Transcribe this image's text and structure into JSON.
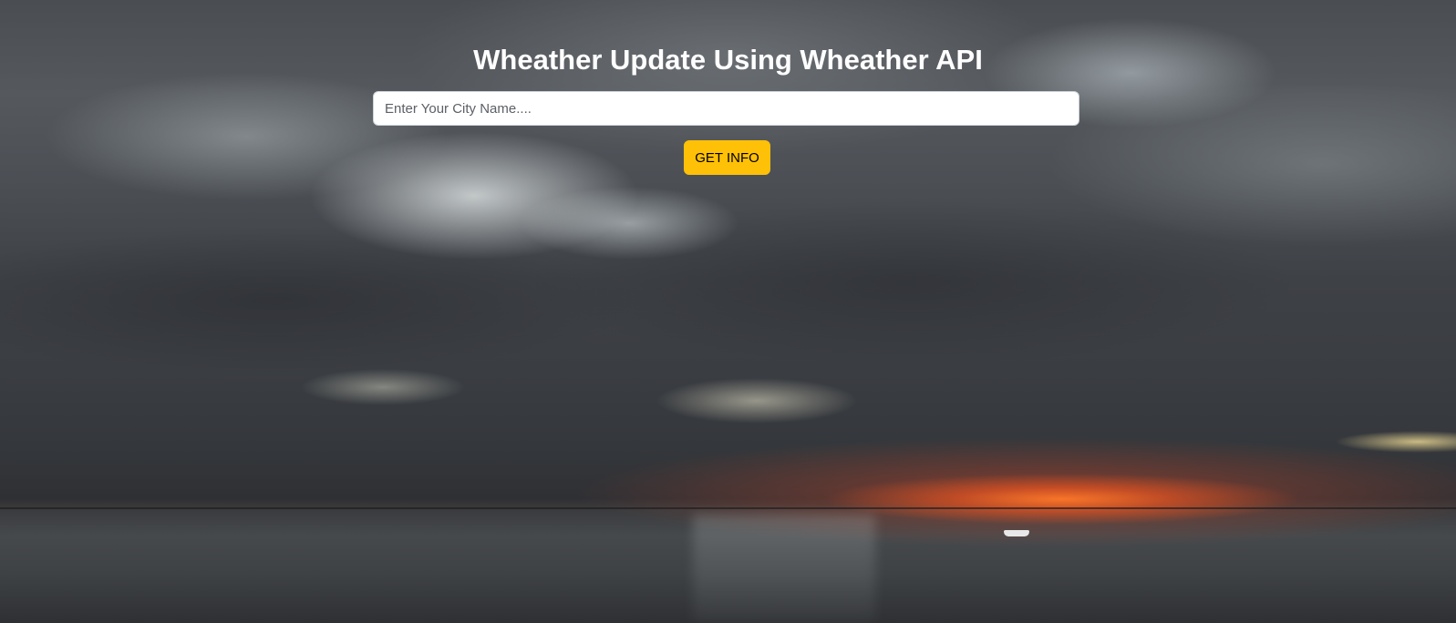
{
  "page": {
    "title": "Wheather Update Using Wheather API"
  },
  "search": {
    "placeholder": "Enter Your City Name....",
    "value": ""
  },
  "actions": {
    "get_info_label": "GET INFO"
  },
  "colors": {
    "button_bg": "#ffc107",
    "title_color": "#ffffff",
    "input_bg": "#ffffff"
  }
}
